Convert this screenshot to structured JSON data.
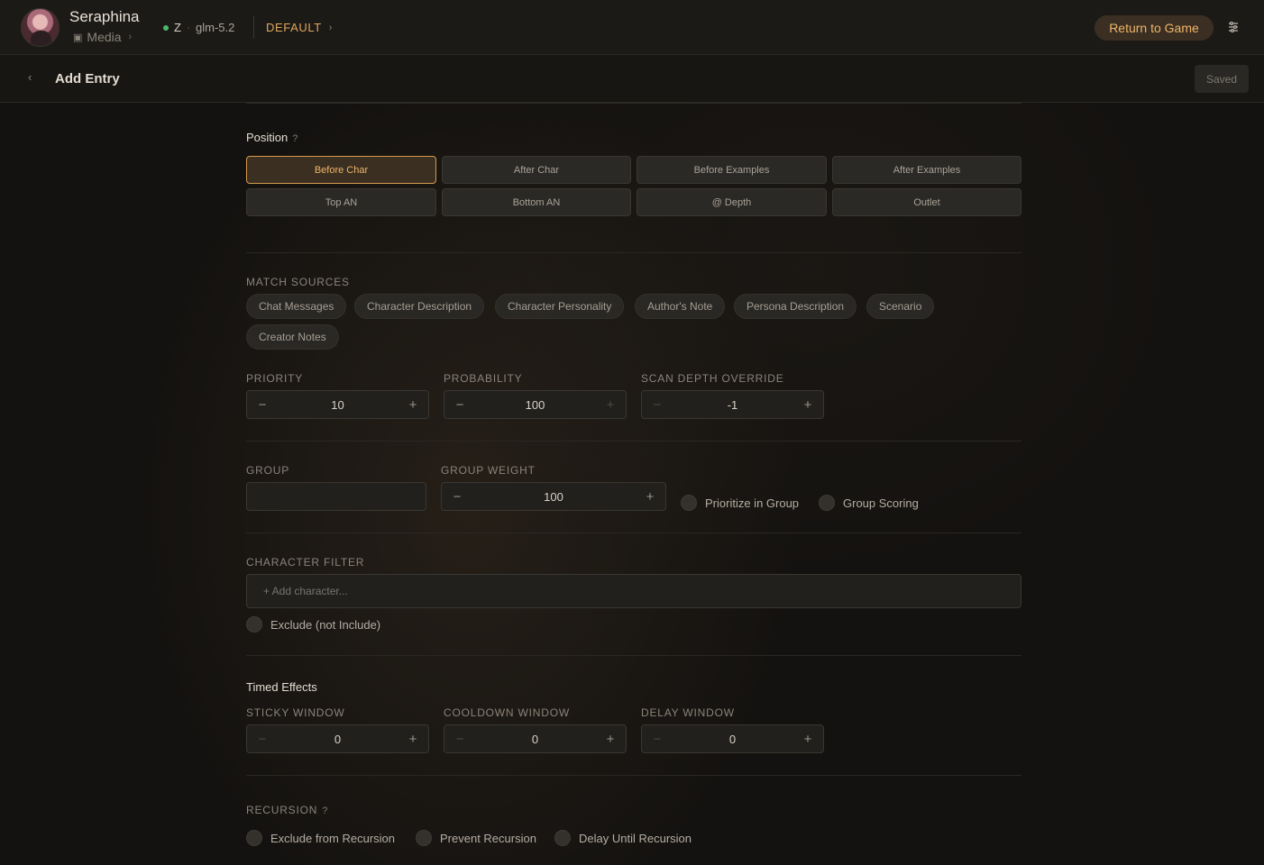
{
  "header": {
    "character_name": "Seraphina",
    "media_label": "Media",
    "media_icon": "media-icon",
    "provider": "Z",
    "model": "glm-5.2",
    "preset": "DEFAULT",
    "return_label": "Return to Game",
    "status_color": "#4bb86a",
    "accent_color": "#f0b46a"
  },
  "subheader": {
    "title": "Add Entry",
    "saved_label": "Saved"
  },
  "position": {
    "title": "Position",
    "help": "?",
    "selected": "Before Char",
    "options": [
      "Before Char",
      "After Char",
      "Before Examples",
      "After Examples",
      "Top AN",
      "Bottom AN",
      "@ Depth",
      "Outlet"
    ]
  },
  "match_sources": {
    "label": "MATCH SOURCES",
    "chips": [
      "Chat Messages",
      "Character Description",
      "Character Personality",
      "Author's Note",
      "Persona Description",
      "Scenario",
      "Creator Notes"
    ]
  },
  "numbers": {
    "priority": {
      "label": "PRIORITY",
      "value": "10"
    },
    "probability": {
      "label": "PROBABILITY",
      "value": "100"
    },
    "scan_depth": {
      "label": "SCAN DEPTH OVERRIDE",
      "value": "-1"
    }
  },
  "group": {
    "label": "GROUP",
    "value": "",
    "weight_label": "GROUP WEIGHT",
    "weight_value": "100",
    "prioritize_label": "Prioritize in Group",
    "scoring_label": "Group Scoring"
  },
  "character_filter": {
    "label": "CHARACTER FILTER",
    "placeholder": "+ Add character...",
    "exclude_label": "Exclude (not Include)"
  },
  "timed_effects": {
    "title": "Timed Effects",
    "sticky": {
      "label": "STICKY WINDOW",
      "value": "0"
    },
    "cooldown": {
      "label": "COOLDOWN WINDOW",
      "value": "0"
    },
    "delay": {
      "label": "DELAY WINDOW",
      "value": "0"
    }
  },
  "recursion": {
    "label": "RECURSION",
    "help": "?",
    "options": [
      "Exclude from Recursion",
      "Prevent Recursion",
      "Delay Until Recursion"
    ]
  },
  "steppers": {
    "minus": "−",
    "plus": "+"
  }
}
